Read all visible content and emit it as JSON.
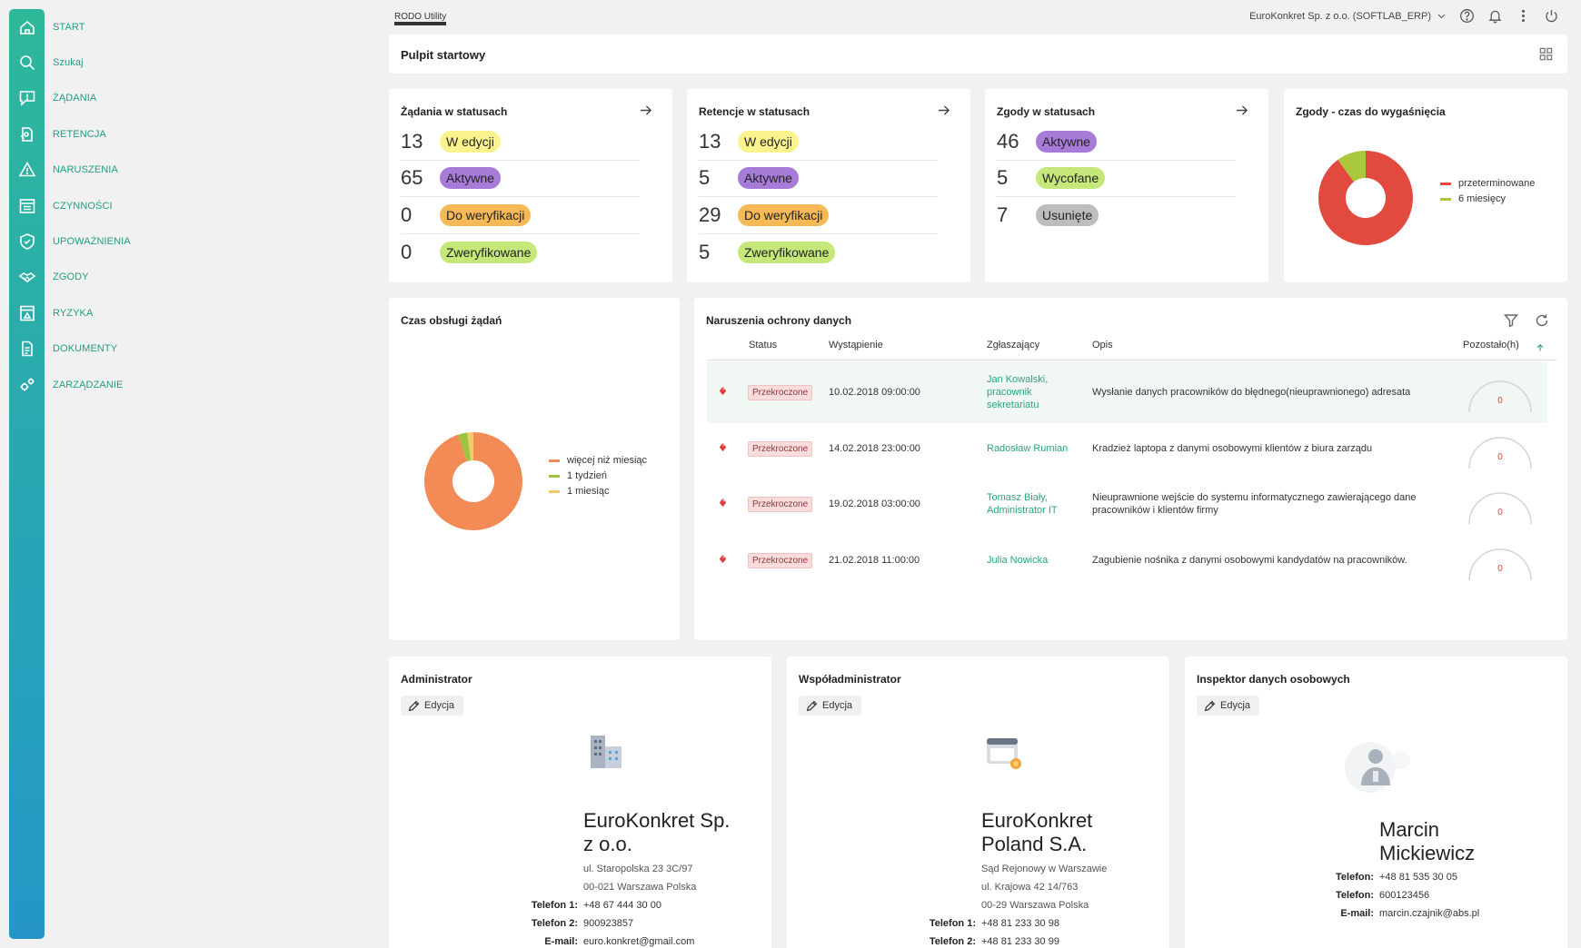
{
  "nav": [
    {
      "label": "START",
      "icon": "home-icon"
    },
    {
      "label": "Szukaj",
      "icon": "search-icon"
    },
    {
      "label": "ŻĄDANIA",
      "icon": "chat-alert-icon"
    },
    {
      "label": "RETENCJA",
      "icon": "retention-icon"
    },
    {
      "label": "NARUSZENIA",
      "icon": "warning-icon"
    },
    {
      "label": "CZYNNOŚCI",
      "icon": "list-icon"
    },
    {
      "label": "UPOWAŻNIENIA",
      "icon": "shield-check-icon"
    },
    {
      "label": "ZGODY",
      "icon": "handshake-icon"
    },
    {
      "label": "RYZYKA",
      "icon": "risk-icon"
    },
    {
      "label": "DOKUMENTY",
      "icon": "document-icon"
    },
    {
      "label": "ZARZĄDZANIE",
      "icon": "gears-icon"
    }
  ],
  "header": {
    "brand": "RODO Utility",
    "organization": "EuroKonkret Sp. z o.o. (SOFTLAB_ERP)"
  },
  "pulpit": {
    "title": "Pulpit startowy"
  },
  "stats": [
    {
      "title": "Żądania w statusach",
      "rows": [
        {
          "count": "13",
          "label": "W edycji",
          "color": "#fbf48e"
        },
        {
          "count": "65",
          "label": "Aktywne",
          "color": "#a77bd8"
        },
        {
          "count": "0",
          "label": "Do weryfikacji",
          "color": "#f7b955"
        },
        {
          "count": "0",
          "label": "Zweryfikowane",
          "color": "#c6e77a"
        }
      ]
    },
    {
      "title": "Retencje w statusach",
      "rows": [
        {
          "count": "13",
          "label": "W edycji",
          "color": "#fbf48e"
        },
        {
          "count": "5",
          "label": "Aktywne",
          "color": "#a77bd8"
        },
        {
          "count": "29",
          "label": "Do weryfikacji",
          "color": "#f7b955"
        },
        {
          "count": "5",
          "label": "Zweryfikowane",
          "color": "#c6e77a"
        }
      ]
    },
    {
      "title": "Zgody w statusach",
      "rows": [
        {
          "count": "46",
          "label": "Aktywne",
          "color": "#a77bd8"
        },
        {
          "count": "5",
          "label": "Wycofane",
          "color": "#c6e77a"
        },
        {
          "count": "7",
          "label": "Usunięte",
          "color": "#bdbdbd"
        }
      ]
    }
  ],
  "expiry": {
    "title": "Zgody - czas do wygaśnięcia",
    "legend": [
      {
        "label": "przeterminowane",
        "color": "#e34a3f"
      },
      {
        "label": "6 miesięcy",
        "color": "#a9c83c"
      }
    ]
  },
  "handling": {
    "title": "Czas obsługi żądań",
    "legend": [
      {
        "label": "więcej niż miesiąc",
        "color": "#f28b56"
      },
      {
        "label": "1 tydzień",
        "color": "#9cc43e"
      },
      {
        "label": "1 miesiąc",
        "color": "#f5c86a"
      }
    ]
  },
  "chart_data": [
    {
      "type": "pie",
      "title": "Zgody - czas do wygaśnięcia",
      "categories": [
        "przeterminowane",
        "6 miesięcy"
      ],
      "values": [
        90,
        10
      ],
      "colors": [
        "#e34a3f",
        "#a9c83c"
      ],
      "legend": "right"
    },
    {
      "type": "pie",
      "title": "Czas obsługi żądań",
      "categories": [
        "więcej niż miesiąc",
        "1 tydzień",
        "1 miesiąc"
      ],
      "values": [
        95,
        3,
        2
      ],
      "colors": [
        "#f28b56",
        "#9cc43e",
        "#f5c86a"
      ],
      "legend": "right"
    }
  ],
  "breaches": {
    "title": "Naruszenia ochrony danych",
    "columns": {
      "status": "Status",
      "occurred": "Wystąpienie",
      "reporter": "Zgłaszający",
      "description": "Opis",
      "remaining": "Pozostało(h)"
    },
    "rows": [
      {
        "status": "Przekroczone",
        "occurred": "10.02.2018 09:00:00",
        "reporter": "Jan Kowalski, pracownik sekretariatu",
        "description": "Wysłanie danych pracowników do błędnego(nieuprawnionego) adresata",
        "remaining": "0"
      },
      {
        "status": "Przekroczone",
        "occurred": "14.02.2018 23:00:00",
        "reporter": "Radosław Rumian",
        "description": "Kradzież laptopa z danymi osobowymi klientów z biura zarządu",
        "remaining": "0"
      },
      {
        "status": "Przekroczone",
        "occurred": "19.02.2018 03:00:00",
        "reporter": "Tomasz Biały, Administrator IT",
        "description": "Nieuprawnione wejście do systemu informatycznego zawierającego dane pracowników i klientów firmy",
        "remaining": "0"
      },
      {
        "status": "Przekroczone",
        "occurred": "21.02.2018 11:00:00",
        "reporter": "Julia Nowicka",
        "description": "Zagubienie nośnika z danymi osobowymi kandydatów na pracowników.",
        "remaining": "0"
      }
    ]
  },
  "admin": {
    "title": "Administrator",
    "edit": "Edycja",
    "name_line1": "EuroKonkret Sp.",
    "name_line2": "z o.o.",
    "addr1": "ul. Staropolska 23 3C/97",
    "addr2": "00-021 Warszawa Polska",
    "phone1_label": "Telefon 1:",
    "phone1": "+48 67 444 30 00",
    "phone2_label": "Telefon 2:",
    "phone2": "900923857",
    "email_label": "E-mail:",
    "email": "euro.konkret@gmail.com"
  },
  "coadmin": {
    "title": "Współadministrator",
    "edit": "Edycja",
    "name_line1": "EuroKonkret",
    "name_line2": "Poland S.A.",
    "court": "Sąd Rejonowy w Warszawie",
    "addr1": "ul. Krajowa 42 14/763",
    "addr2": "00-29 Warszawa Polska",
    "phone1_label": "Telefon 1:",
    "phone1": "+48 81 233 30 98",
    "phone2_label": "Telefon 2:",
    "phone2": "+48 81 233 30 99"
  },
  "inspector": {
    "title": "Inspektor danych osobowych",
    "edit": "Edycja",
    "name_line1": "Marcin",
    "name_line2": "Mickiewicz",
    "phone1_label": "Telefon:",
    "phone1": "+48 81 535 30 05",
    "phone2_label": "Telefon:",
    "phone2": "600123456",
    "email_label": "E-mail:",
    "email": "marcin.czajnik@abs.pl"
  }
}
